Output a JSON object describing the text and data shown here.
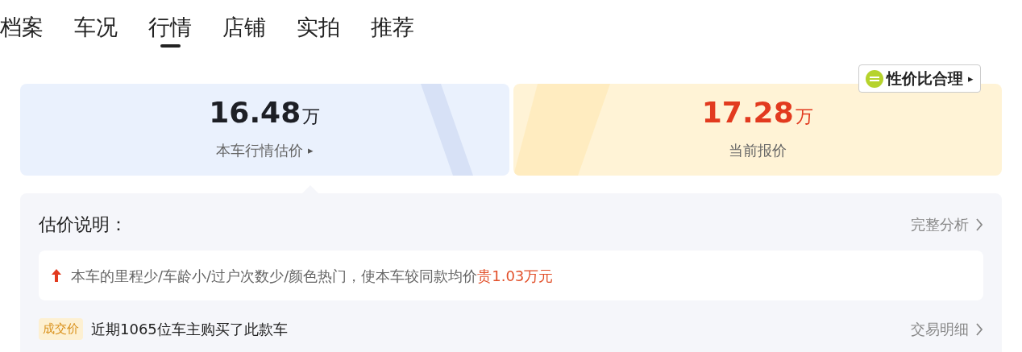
{
  "tabs": [
    {
      "label": "档案",
      "selected": false
    },
    {
      "label": "车况",
      "selected": false
    },
    {
      "label": "行情",
      "selected": true
    },
    {
      "label": "店铺",
      "selected": false
    },
    {
      "label": "实拍",
      "selected": false
    },
    {
      "label": "推荐",
      "selected": false
    }
  ],
  "price_cards": [
    {
      "kind": "estimate",
      "value": "16.48",
      "unit": "万",
      "label": "本车行情估价",
      "arrow": "▸"
    },
    {
      "kind": "quote",
      "value": "17.28",
      "unit": "万",
      "label": "当前报价",
      "badge": {
        "text": "性价比合理",
        "arrow": "▸"
      }
    }
  ],
  "panel": {
    "title": "估价说明：",
    "link": "完整分析",
    "reason": {
      "text": "本车的里程少/车龄小/过户次数少/颜色热门，使本车较同款均价",
      "highlight": "贵1.03万元"
    },
    "deal": {
      "tag": "成交价",
      "text": "近期1065位车主购买了此款车",
      "link": "交易明细"
    }
  }
}
